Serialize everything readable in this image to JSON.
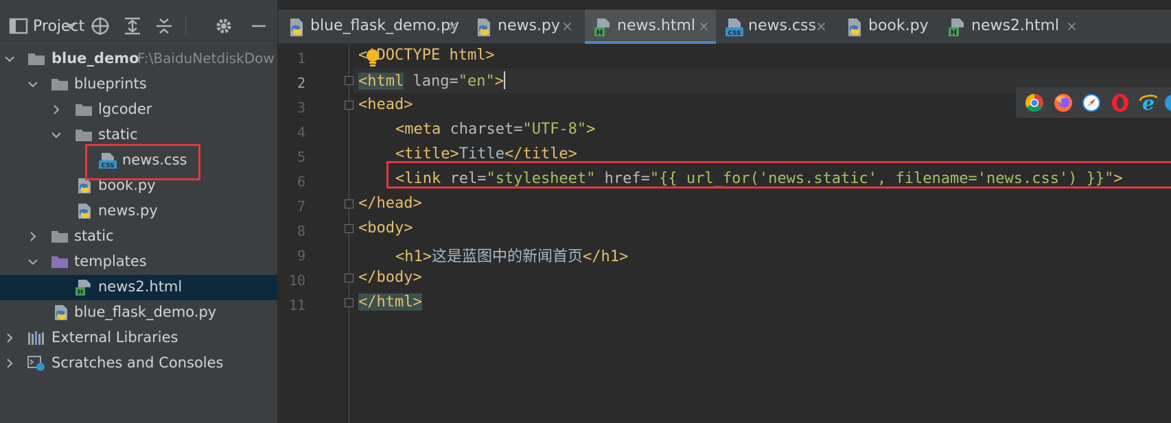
{
  "project_panel": {
    "title": "Project",
    "toolbar_icons": [
      "dropdown-icon",
      "locate-icon",
      "expand-all-icon",
      "collapse-all-icon",
      "gear-icon",
      "hide-icon"
    ],
    "tree": [
      {
        "label": "blue_demo",
        "path": "F:\\BaiduNetdiskDow",
        "type": "folder",
        "expanded": true
      },
      {
        "label": "blueprints",
        "type": "folder",
        "expanded": true
      },
      {
        "label": "lgcoder",
        "type": "folder",
        "expanded": false
      },
      {
        "label": "static",
        "type": "folder",
        "expanded": true
      },
      {
        "label": "news.css",
        "type": "css"
      },
      {
        "label": "book.py",
        "type": "python"
      },
      {
        "label": "news.py",
        "type": "python"
      },
      {
        "label": "static",
        "type": "folder",
        "expanded": false
      },
      {
        "label": "templates",
        "type": "folder-purple",
        "expanded": true
      },
      {
        "label": "news2.html",
        "type": "html",
        "selected": true
      },
      {
        "label": "blue_flask_demo.py",
        "type": "python"
      },
      {
        "label": "External Libraries",
        "type": "libraries",
        "expanded": false
      },
      {
        "label": "Scratches and Consoles",
        "type": "scratches",
        "expanded": false
      }
    ]
  },
  "tabs": [
    {
      "label": "blue_flask_demo.py",
      "icon": "python-file-icon",
      "active": false
    },
    {
      "label": "news.py",
      "icon": "python-file-icon",
      "active": false
    },
    {
      "label": "news.html",
      "icon": "html-file-icon",
      "active": true
    },
    {
      "label": "news.css",
      "icon": "css-file-icon",
      "active": false
    },
    {
      "label": "book.py",
      "icon": "python-file-icon",
      "active": false
    },
    {
      "label": "news2.html",
      "icon": "html-file-icon",
      "active": false
    }
  ],
  "tab_close_glyph": "×",
  "editor": {
    "line_numbers": [
      "1",
      "2",
      "3",
      "4",
      "5",
      "6",
      "7",
      "8",
      "9",
      "10",
      "11"
    ],
    "current_line": "2",
    "lines": {
      "l1": {
        "lt": "<",
        "rest": "!DOCTYPE html>"
      },
      "l2": {
        "open": "<html",
        "attr": " lang=",
        "val": "\"en\"",
        "close": ">"
      },
      "l3": {
        "tag": "<head>"
      },
      "l4": {
        "open": "<meta",
        "attr": " charset=",
        "val": "\"UTF-8\"",
        "close": ">"
      },
      "l5": {
        "open": "<title>",
        "text": "Title",
        "close": "</title>"
      },
      "l6": {
        "open": "<link",
        "attr1": " rel=",
        "val1": "\"stylesheet\"",
        "attr2": " href=",
        "val2": "\"{{ url_for('news.static', filename='news.css') }}\"",
        "close": ">"
      },
      "l7": {
        "tag": "</head>"
      },
      "l8": {
        "tag": "<body>"
      },
      "l9": {
        "open": "<h1>",
        "text": "这是蓝图中的新闻首页",
        "close": "</h1>"
      },
      "l10": {
        "tag": "</body>"
      },
      "l11": {
        "tag": "</html>"
      }
    }
  },
  "browsers": [
    "chrome-icon",
    "firefox-icon",
    "safari-icon",
    "opera-icon",
    "ie-icon",
    "edge-icon"
  ],
  "colors": {
    "highlight_red": "#e0393e",
    "active_tab_underline": "#4a88c7",
    "tag": "#e8bf6a",
    "string": "#a5c261",
    "selection": "#0d293e"
  }
}
